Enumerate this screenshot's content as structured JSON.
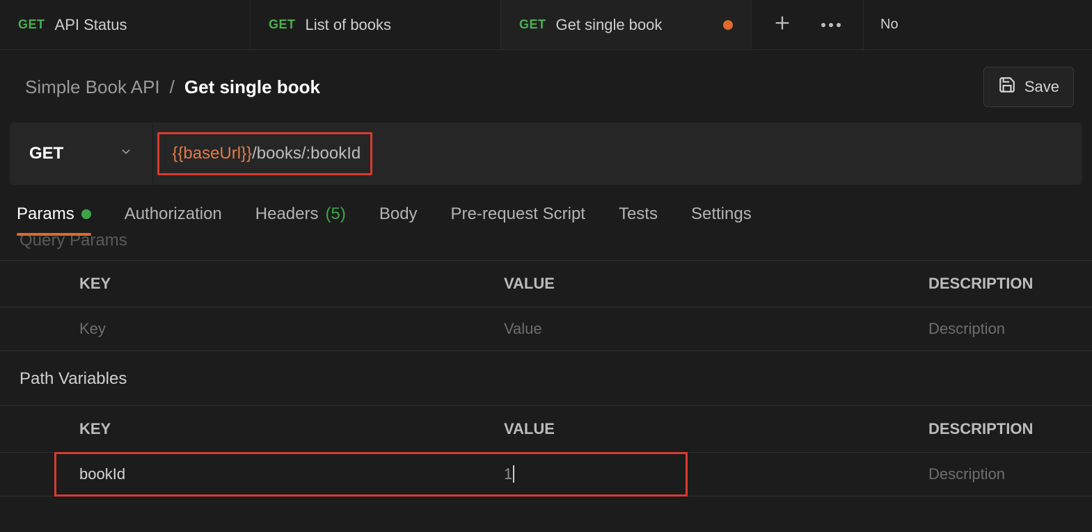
{
  "tabs": [
    {
      "method": "GET",
      "label": "API Status",
      "active": false,
      "unsaved": false
    },
    {
      "method": "GET",
      "label": "List of books",
      "active": false,
      "unsaved": false
    },
    {
      "method": "GET",
      "label": "Get single book",
      "active": true,
      "unsaved": true
    }
  ],
  "tab_right_label": "No",
  "breadcrumb": {
    "collection": "Simple Book API",
    "current": "Get single book",
    "sep": "/"
  },
  "save_label": "Save",
  "request": {
    "method": "GET",
    "url_variable": "{{baseUrl}}",
    "url_path": "/books/:bookId"
  },
  "req_tabs": {
    "params": "Params",
    "authorization": "Authorization",
    "headers": "Headers",
    "headers_count": "(5)",
    "body": "Body",
    "pre": "Pre-request Script",
    "tests": "Tests",
    "settings": "Settings"
  },
  "query_params_heading": "Query Params",
  "columns": {
    "key": "KEY",
    "value": "VALUE",
    "description": "DESCRIPTION"
  },
  "placeholders": {
    "key": "Key",
    "value": "Value",
    "description": "Description"
  },
  "path_variables_heading": "Path Variables",
  "path_vars": [
    {
      "key": "bookId",
      "value": "1",
      "description": ""
    }
  ]
}
